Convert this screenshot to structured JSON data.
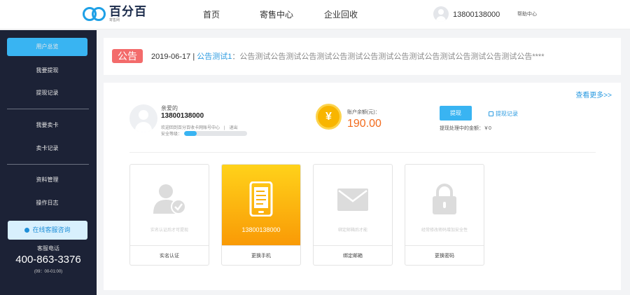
{
  "header": {
    "logo_text": "百分百",
    "logo_sub": "寄售网",
    "nav": [
      "首页",
      "寄售中心",
      "企业回收"
    ],
    "user_phone": "13800138000",
    "help": "帮助中心"
  },
  "sidebar": {
    "items": [
      "用户总览",
      "我要提现",
      "提现记录",
      "我要卖卡",
      "卖卡记录",
      "资料管理",
      "操作日志"
    ],
    "service_button": "在线客服咨询",
    "hotline_label": "客服电话",
    "hotline_number": "400-863-3376",
    "hotline_hours": "(09：00-01:00)"
  },
  "notice": {
    "badge": "公告",
    "date": "2019-06-17 |",
    "title": "公告测试1",
    "content": "：公告测试公告测试公告测试公告测试公告测试公告测试公告测试公告测试公告测试公告****"
  },
  "account": {
    "more": "查看更多>>",
    "greeting": "亲爱的",
    "phone": "13800138000",
    "welcome": "欢迎回到百分百收卡网账号中心",
    "logout": "退出",
    "security_label": "安全等级：",
    "security_level": 0.2,
    "balance_label": "账户余额(元)：",
    "balance": "190.00",
    "coin_symbol": "¥",
    "withdraw_button": "提现",
    "withdraw_record": "提现记录",
    "processing": "提现处理中的金额：￥0"
  },
  "cards": [
    {
      "desc": "实名认证后才可提现",
      "label": "实名认证",
      "icon": "user-check-icon",
      "active": false
    },
    {
      "desc": "13800138000",
      "label": "更换手机",
      "icon": "phone-icon",
      "active": true
    },
    {
      "desc": "绑定邮箱后才能",
      "label": "绑定邮箱",
      "icon": "envelope-icon",
      "active": false
    },
    {
      "desc": "经常修改密码增加安全性",
      "label": "更换密码",
      "icon": "lock-icon",
      "active": false
    }
  ],
  "colors": {
    "accent": "#39b4f2",
    "sidebar": "#1c2236",
    "balance": "#f26b1d",
    "badge": "#f36b6b"
  }
}
